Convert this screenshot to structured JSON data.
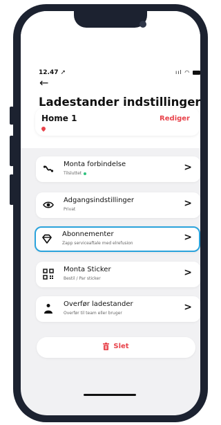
{
  "status_bar": {
    "time": "12.47",
    "icons": "signal-wifi-battery"
  },
  "header": {
    "back_icon": "arrow-left-icon",
    "title": "Ladestander indstillinger"
  },
  "home_card": {
    "name": "Home 1",
    "edit_label": "Rediger"
  },
  "menu": {
    "items": [
      {
        "title": "Monta forbindelse",
        "subtitle": "Tilsluttet",
        "icon": "connection-icon",
        "status_color": "#2ec27e"
      },
      {
        "title": "Adgangsindstillinger",
        "subtitle": "Privat",
        "icon": "eye-icon"
      },
      {
        "title": "Abonnementer",
        "subtitle": "Zapp serviceaftale med elrefusion",
        "icon": "diamond-icon",
        "selected": true
      },
      {
        "title": "Monta Sticker",
        "subtitle": "Bestil / Par sticker",
        "icon": "qr-code-icon"
      },
      {
        "title": "Overfør ladestander",
        "subtitle": "Overfør til team eller bruger",
        "icon": "transfer-user-icon"
      }
    ]
  },
  "delete": {
    "label": "Slet",
    "icon": "trash-icon"
  },
  "colors": {
    "accent_red": "#e8434b",
    "selected_border": "#2aa3dc",
    "status_green": "#2ec27e"
  }
}
